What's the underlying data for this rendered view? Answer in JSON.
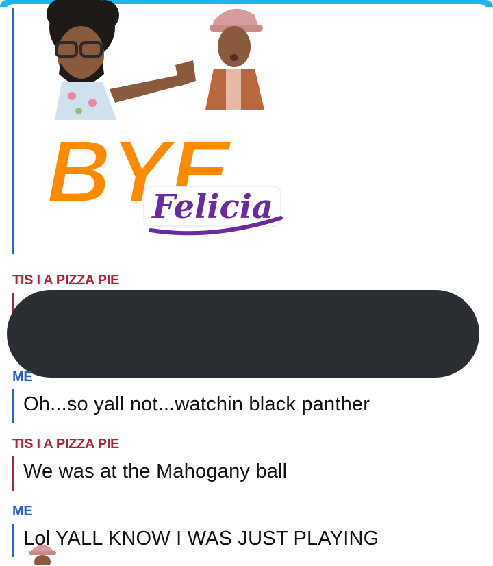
{
  "sticker": {
    "word_big": "BYE",
    "word_script": "Felicia",
    "colors": {
      "orange": "#ff8a00",
      "purple": "#6a2aa0"
    }
  },
  "messages": [
    {
      "sender": "TIS I A PIZZA PIE",
      "text": ""
    },
    {
      "sender": "ME",
      "text": "Oh...so yall not...watchin black panther"
    },
    {
      "sender": "TIS I A PIZZA PIE",
      "text": "We was at the Mahogany ball"
    },
    {
      "sender": "ME",
      "text": "Lol YALL KNOW I WAS JUST PLAYING"
    }
  ],
  "colors": {
    "friend": "#b0223a",
    "me": "#2f5fc9",
    "redaction": "#2b2f33",
    "frame": "#1fb5ee"
  }
}
